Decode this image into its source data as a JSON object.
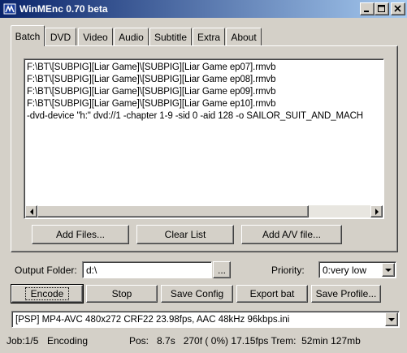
{
  "window": {
    "title": "WinMEnc 0.70 beta",
    "minimize": "_",
    "maximize": "□",
    "close": "✕"
  },
  "tabs": [
    "Batch",
    "DVD",
    "Video",
    "Audio",
    "Subtitle",
    "Extra",
    "About"
  ],
  "batch": {
    "list": [
      "F:\\BT\\[SUBPIG][Liar Game]\\[SUBPIG][Liar Game ep07].rmvb",
      "F:\\BT\\[SUBPIG][Liar Game]\\[SUBPIG][Liar Game ep08].rmvb",
      "F:\\BT\\[SUBPIG][Liar Game]\\[SUBPIG][Liar Game ep09].rmvb",
      "F:\\BT\\[SUBPIG][Liar Game]\\[SUBPIG][Liar Game ep10].rmvb",
      "-dvd-device \"h:\" dvd://1 -chapter 1-9 -sid 0 -aid 128 -o SAILOR_SUIT_AND_MACH"
    ],
    "add_files": "Add Files...",
    "clear_list": "Clear List",
    "add_av": "Add A/V file..."
  },
  "output": {
    "label": "Output Folder:",
    "value": "d:\\",
    "browse": "...",
    "priority_label": "Priority:",
    "priority_value": "0:very low"
  },
  "actions": {
    "encode": "Encode",
    "stop": "Stop",
    "save_config": "Save Config",
    "export_bat": "Export bat",
    "save_profile": "Save Profile..."
  },
  "profile": {
    "value": "[PSP] MP4-AVC 480x272 CRF22 23.98fps, AAC 48kHz 96kbps.ini"
  },
  "status": {
    "job": "Job:1/5",
    "state": "Encoding",
    "pos": "Pos:   8.7s   270f ( 0%) 17.15fps Trem:  52min 127mb"
  },
  "colors": {
    "face": "#d4d0c8",
    "title_start": "#0a246a",
    "title_end": "#a6caf0"
  }
}
